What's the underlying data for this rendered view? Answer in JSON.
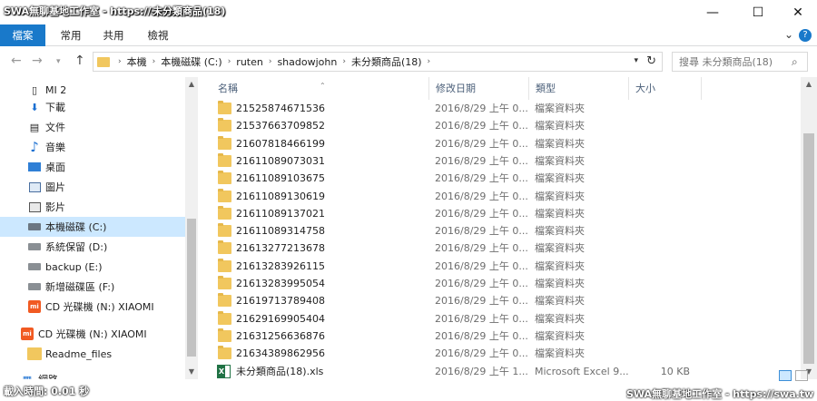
{
  "window": {
    "title_watermark": "SWA無聊基地工作室 - https://swa.tw",
    "title_tail": "未分類商品(18)",
    "minimize_glyph": "—",
    "maximize_glyph": "☐",
    "close_glyph": "✕"
  },
  "ribbon": {
    "tabs": [
      "檔案",
      "常用",
      "共用",
      "檢視"
    ],
    "expand_glyph": "⌄",
    "help_glyph": "?"
  },
  "address": {
    "crumbs": [
      "本機",
      "本機磁碟 (C:)",
      "ruten",
      "shadowjohn",
      "未分類商品(18)"
    ],
    "search_placeholder": "搜尋 未分類商品(18)"
  },
  "navpane": {
    "items": [
      {
        "label": "MI 2",
        "icon": "phone-icon"
      },
      {
        "label": "下載",
        "icon": "download-icon"
      },
      {
        "label": "文件",
        "icon": "document-icon"
      },
      {
        "label": "音樂",
        "icon": "music-icon"
      },
      {
        "label": "桌面",
        "icon": "desktop-icon"
      },
      {
        "label": "圖片",
        "icon": "pictures-icon"
      },
      {
        "label": "影片",
        "icon": "videos-icon"
      },
      {
        "label": "本機磁碟 (C:)",
        "icon": "drive-c-icon",
        "selected": true
      },
      {
        "label": "系統保留 (D:)",
        "icon": "drive-icon"
      },
      {
        "label": "backup (E:)",
        "icon": "drive-icon"
      },
      {
        "label": "新增磁碟區 (F:)",
        "icon": "drive-icon"
      },
      {
        "label": "CD 光碟機 (N:) XIAOMI",
        "icon": "xiaomi-icon"
      },
      {
        "label": "CD 光碟機 (N:) XIAOMI",
        "icon": "xiaomi-icon"
      },
      {
        "label": "Readme_files",
        "icon": "folder-icon"
      },
      {
        "label": "網路",
        "icon": "network-icon"
      }
    ]
  },
  "columns": {
    "name": "名稱",
    "date": "修改日期",
    "type": "類型",
    "size": "大小"
  },
  "files": [
    {
      "name": "21525874671536",
      "date": "2016/8/29 上午 0...",
      "type": "檔案資料夾",
      "size": "",
      "kind": "folder"
    },
    {
      "name": "21537663709852",
      "date": "2016/8/29 上午 0...",
      "type": "檔案資料夾",
      "size": "",
      "kind": "folder"
    },
    {
      "name": "21607818466199",
      "date": "2016/8/29 上午 0...",
      "type": "檔案資料夾",
      "size": "",
      "kind": "folder"
    },
    {
      "name": "21611089073031",
      "date": "2016/8/29 上午 0...",
      "type": "檔案資料夾",
      "size": "",
      "kind": "folder"
    },
    {
      "name": "21611089103675",
      "date": "2016/8/29 上午 0...",
      "type": "檔案資料夾",
      "size": "",
      "kind": "folder"
    },
    {
      "name": "21611089130619",
      "date": "2016/8/29 上午 0...",
      "type": "檔案資料夾",
      "size": "",
      "kind": "folder"
    },
    {
      "name": "21611089137021",
      "date": "2016/8/29 上午 0...",
      "type": "檔案資料夾",
      "size": "",
      "kind": "folder"
    },
    {
      "name": "21611089314758",
      "date": "2016/8/29 上午 0...",
      "type": "檔案資料夾",
      "size": "",
      "kind": "folder"
    },
    {
      "name": "21613277213678",
      "date": "2016/8/29 上午 0...",
      "type": "檔案資料夾",
      "size": "",
      "kind": "folder"
    },
    {
      "name": "21613283926115",
      "date": "2016/8/29 上午 0...",
      "type": "檔案資料夾",
      "size": "",
      "kind": "folder"
    },
    {
      "name": "21613283995054",
      "date": "2016/8/29 上午 0...",
      "type": "檔案資料夾",
      "size": "",
      "kind": "folder"
    },
    {
      "name": "21619713789408",
      "date": "2016/8/29 上午 0...",
      "type": "檔案資料夾",
      "size": "",
      "kind": "folder"
    },
    {
      "name": "21629169905404",
      "date": "2016/8/29 上午 0...",
      "type": "檔案資料夾",
      "size": "",
      "kind": "folder"
    },
    {
      "name": "21631256636876",
      "date": "2016/8/29 上午 0...",
      "type": "檔案資料夾",
      "size": "",
      "kind": "folder"
    },
    {
      "name": "21634389862956",
      "date": "2016/8/29 上午 0...",
      "type": "檔案資料夾",
      "size": "",
      "kind": "folder"
    },
    {
      "name": "未分類商品(18).xls",
      "date": "2016/8/29 上午 1...",
      "type": "Microsoft Excel 9...",
      "size": "10 KB",
      "kind": "xls"
    }
  ],
  "status": {
    "text": "載入時間: 0.01 秒",
    "watermark": "SWA無聊基地工作室 - https://swa.tw"
  },
  "colors": {
    "accent": "#1979ca",
    "selection": "#cce8ff",
    "folder": "#f1c75e",
    "header_text": "#4c607a"
  }
}
